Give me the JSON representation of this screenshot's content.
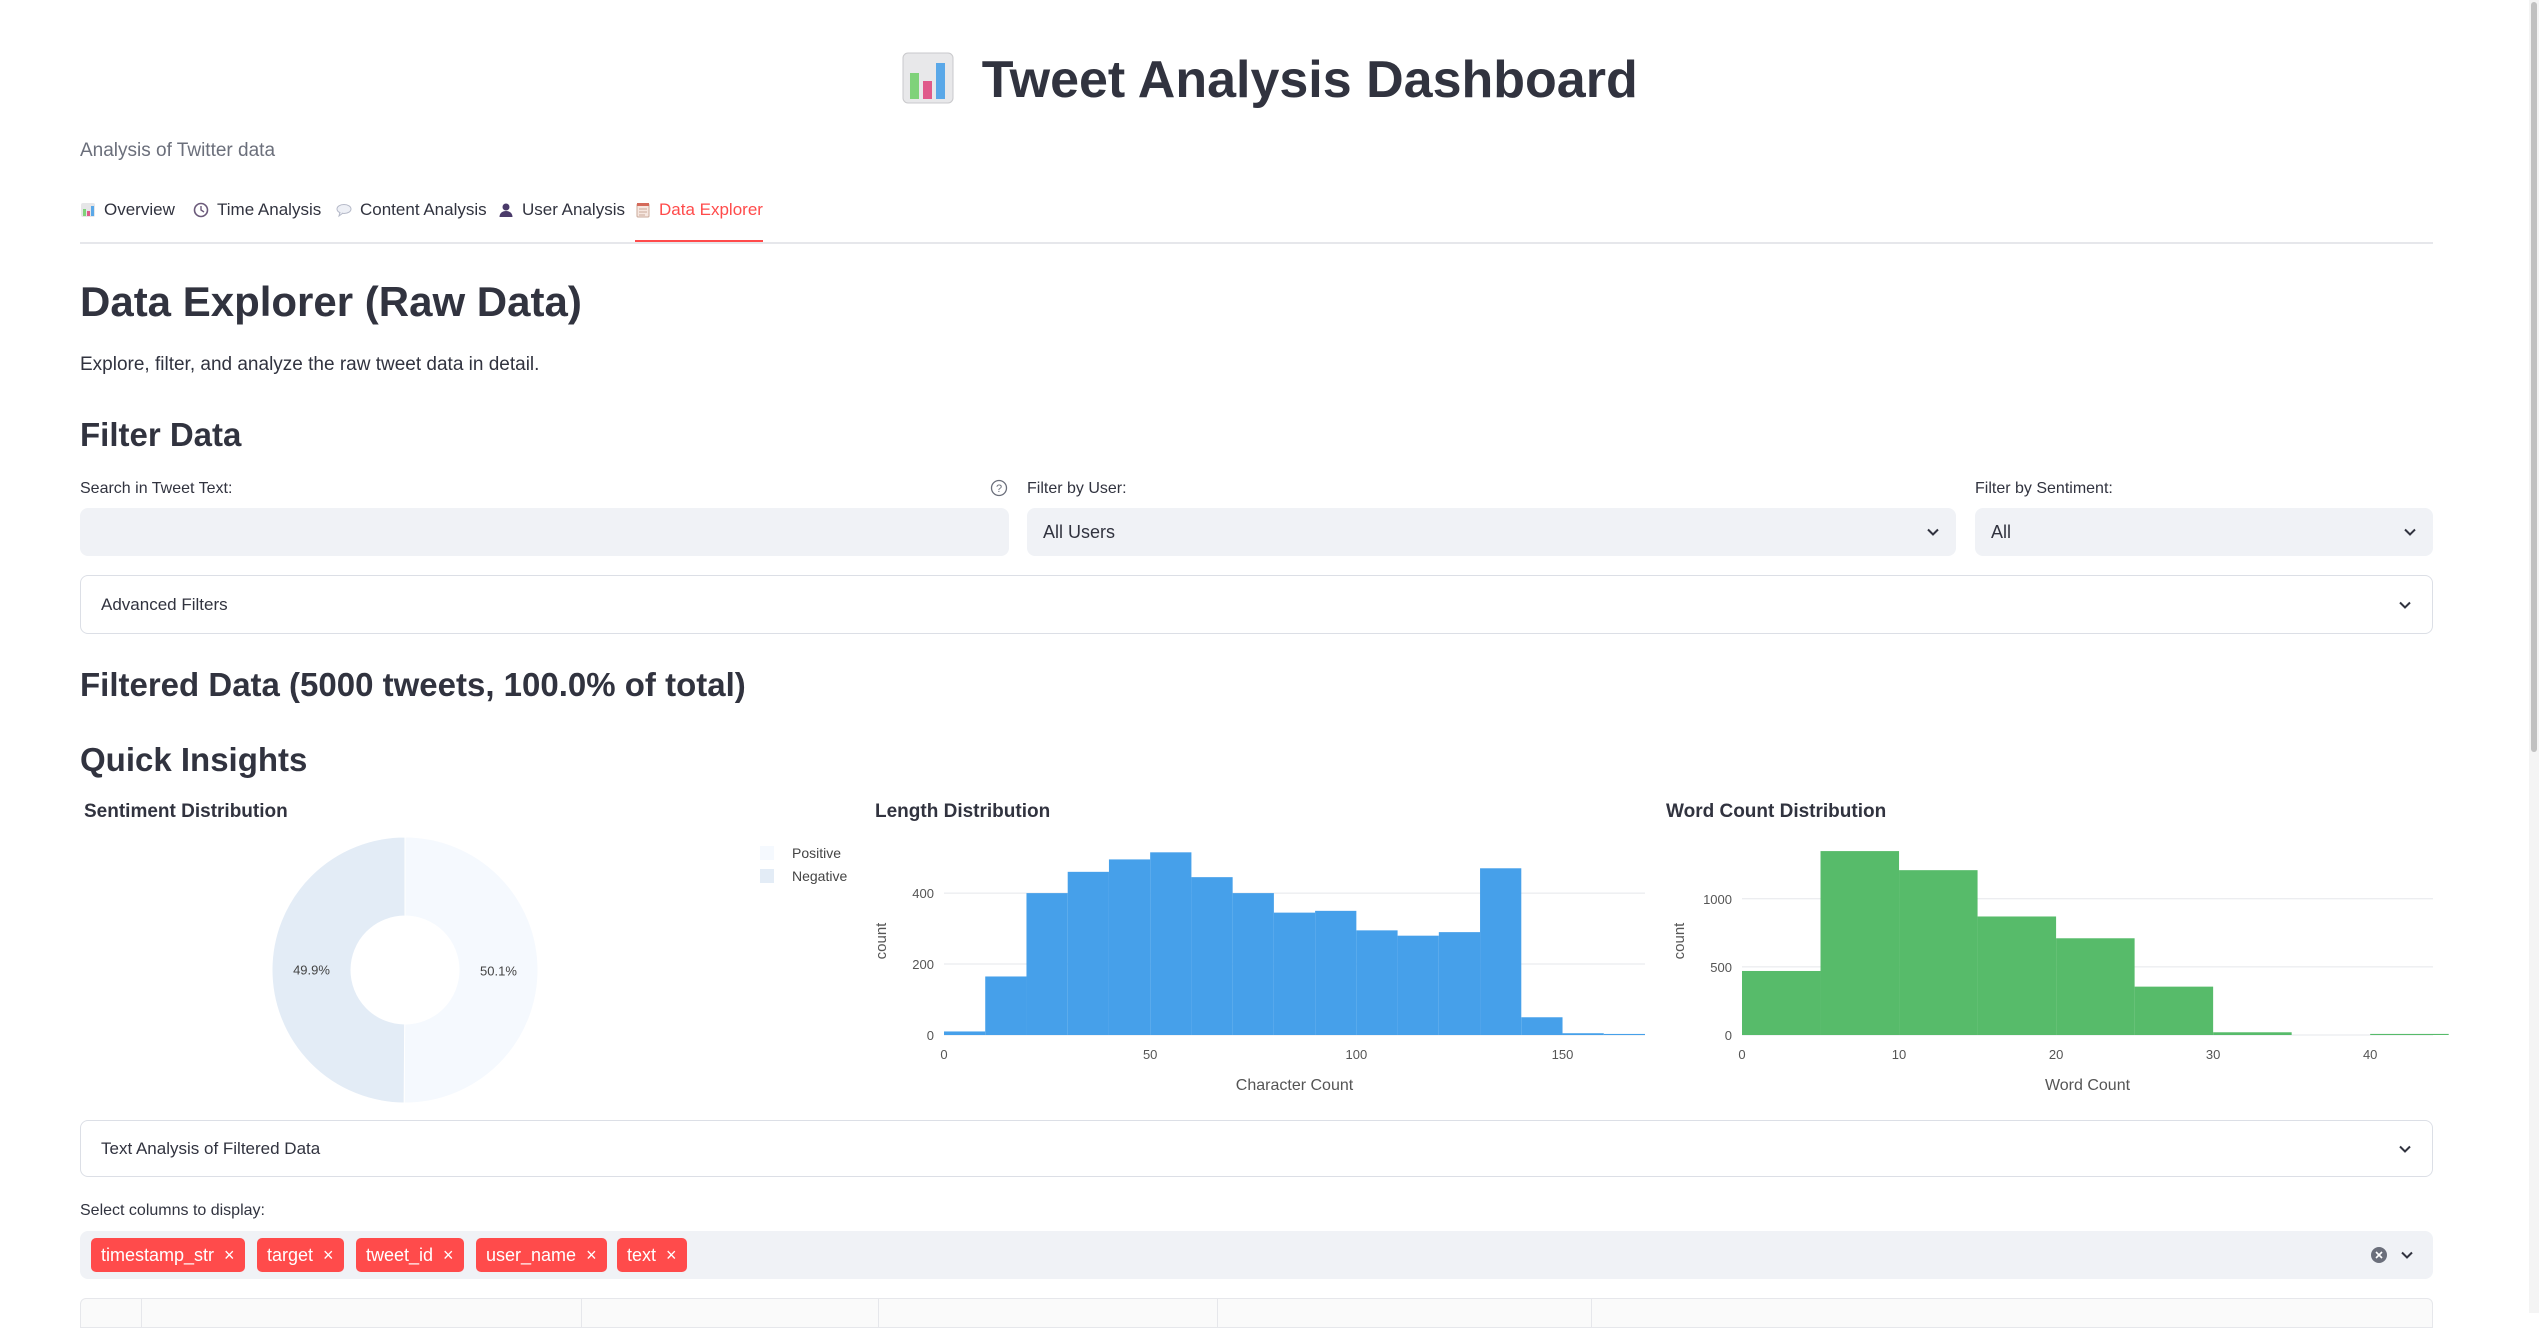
{
  "app": {
    "title": "Tweet Analysis Dashboard",
    "subtitle": "Analysis of Twitter data"
  },
  "tabs": [
    {
      "label": "Overview",
      "icon": "bar-chart-icon",
      "active": false
    },
    {
      "label": "Time Analysis",
      "icon": "clock-icon",
      "active": false
    },
    {
      "label": "Content Analysis",
      "icon": "speech-bubble-icon",
      "active": false
    },
    {
      "label": "User Analysis",
      "icon": "user-icon",
      "active": false
    },
    {
      "label": "Data Explorer",
      "icon": "notepad-icon",
      "active": true
    }
  ],
  "page": {
    "heading": "Data Explorer (Raw Data)",
    "description": "Explore, filter, and analyze the raw tweet data in detail."
  },
  "filters": {
    "heading": "Filter Data",
    "search_label": "Search in Tweet Text:",
    "search_value": "",
    "user_label": "Filter by User:",
    "user_value": "All Users",
    "sentiment_label": "Filter by Sentiment:",
    "sentiment_value": "All",
    "advanced_label": "Advanced Filters"
  },
  "filtered_heading": "Filtered Data (5000 tweets, 100.0% of total)",
  "insights_heading": "Quick Insights",
  "text_analysis_label": "Text Analysis of Filtered Data",
  "columns": {
    "label": "Select columns to display:",
    "selected": [
      "timestamp_str",
      "target",
      "tweet_id",
      "user_name",
      "text"
    ]
  },
  "colors": {
    "accent": "#ff4b4b",
    "length_bar": "#46a0ea",
    "word_bar": "#57bb6a",
    "pie_positive": "#f5f9fe",
    "pie_negative": "#e3ecf6"
  },
  "chart_data": [
    {
      "type": "pie",
      "title": "Sentiment Distribution",
      "donut": true,
      "legend_position": "top-right",
      "slices": [
        {
          "label": "Positive",
          "value": 50.1,
          "text": "50.1%"
        },
        {
          "label": "Negative",
          "value": 49.9,
          "text": "49.9%"
        }
      ]
    },
    {
      "type": "bar",
      "title": "Length Distribution",
      "xlabel": "Character Count",
      "ylabel": "count",
      "xlim": [
        0,
        170
      ],
      "ylim": [
        0,
        530
      ],
      "xticks": [
        0,
        50,
        100,
        150
      ],
      "yticks": [
        0,
        200,
        400
      ],
      "bin_width": 10,
      "bin_starts": [
        0,
        10,
        20,
        30,
        40,
        50,
        60,
        70,
        80,
        90,
        100,
        110,
        120,
        130,
        140,
        150,
        160
      ],
      "values": [
        10,
        165,
        400,
        460,
        495,
        515,
        445,
        400,
        345,
        350,
        295,
        280,
        290,
        470,
        50,
        5,
        3
      ]
    },
    {
      "type": "bar",
      "title": "Word Count Distribution",
      "xlabel": "Word Count",
      "ylabel": "count",
      "xlim": [
        0,
        44
      ],
      "ylim": [
        0,
        1380
      ],
      "xticks": [
        0,
        10,
        20,
        30,
        40
      ],
      "yticks": [
        0,
        500,
        1000
      ],
      "bin_width": 5,
      "bin_starts": [
        0,
        5,
        10,
        15,
        20,
        25,
        30,
        35,
        40
      ],
      "values": [
        470,
        1350,
        1210,
        870,
        710,
        355,
        20,
        0,
        8
      ]
    }
  ]
}
